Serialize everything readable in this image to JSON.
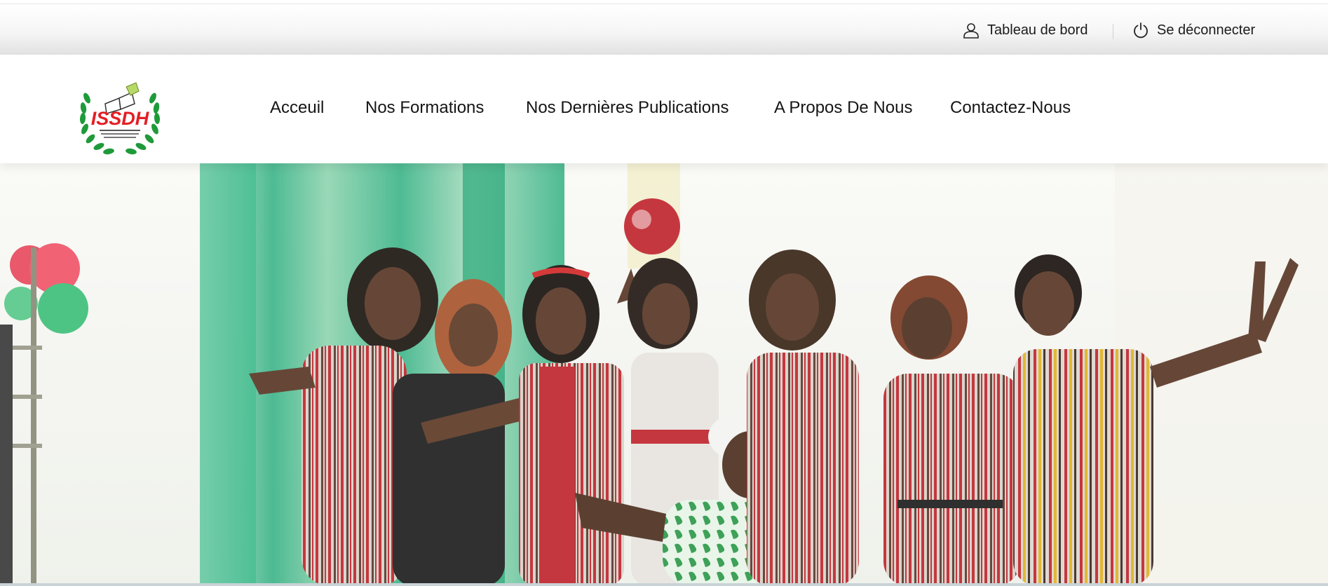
{
  "topbar": {
    "dashboard_label": "Tableau de bord",
    "dashboard_icon": "user-icon",
    "logout_label": "Se déconnecter",
    "logout_icon": "power-icon"
  },
  "brand": {
    "logo_text": "ISSDH",
    "logo_colors": {
      "text": "#e31e24",
      "laurel": "#1f9a3a"
    }
  },
  "nav": {
    "items": [
      {
        "label": "Acceuil"
      },
      {
        "label": "Nos Formations"
      },
      {
        "label": "Nos Dernières Publications"
      },
      {
        "label": "A Propos De Nous"
      },
      {
        "label": "Contactez-Nous"
      }
    ]
  },
  "hero": {
    "image": "group-photo-celebration",
    "colors": {
      "curtain": "#1faa78",
      "fabric_red": "#c0262e",
      "fabric_yellow": "#e0b220"
    }
  }
}
